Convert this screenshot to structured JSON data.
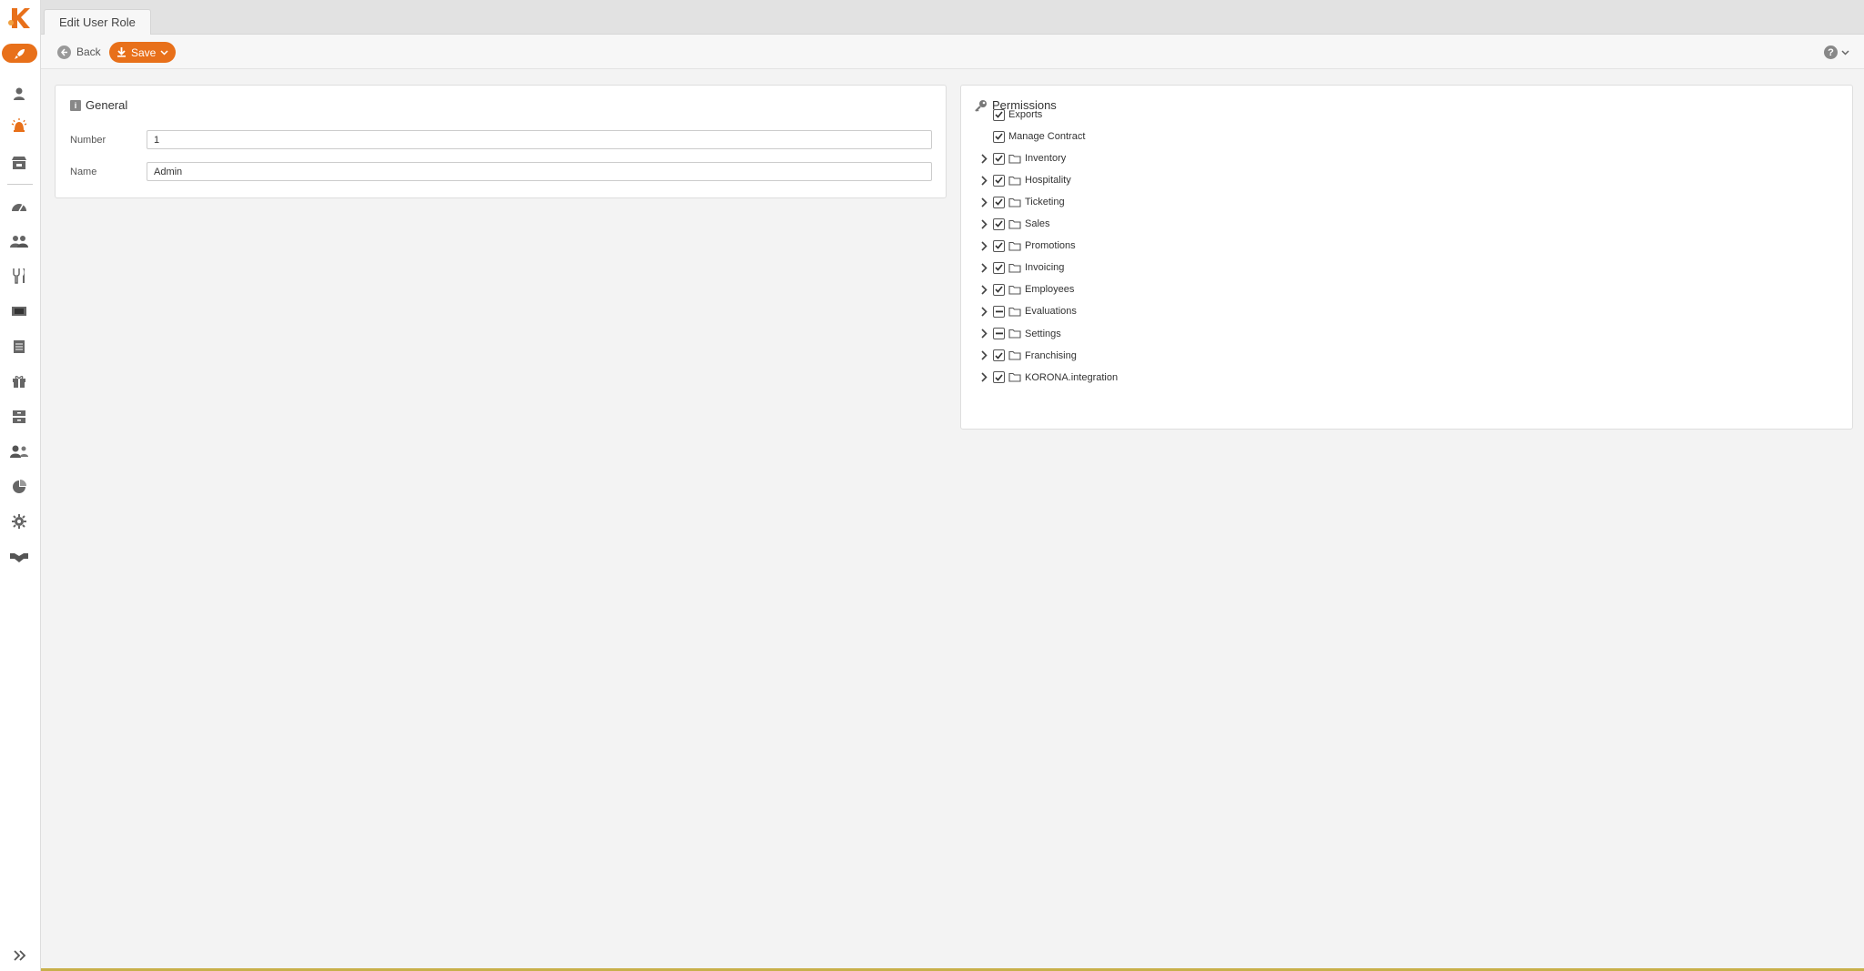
{
  "tab": {
    "title": "Edit User Role"
  },
  "toolbar": {
    "back_label": "Back",
    "save_label": "Save",
    "help_label": "?"
  },
  "general": {
    "title": "General",
    "number_label": "Number",
    "number_value": "1",
    "name_label": "Name",
    "name_value": "Admin"
  },
  "permissions": {
    "title": "Permissions",
    "items": [
      {
        "label": "Exports",
        "state": "checked",
        "expandable": false
      },
      {
        "label": "Manage Contract",
        "state": "checked",
        "expandable": false
      },
      {
        "label": "Inventory",
        "state": "checked",
        "expandable": true
      },
      {
        "label": "Hospitality",
        "state": "checked",
        "expandable": true
      },
      {
        "label": "Ticketing",
        "state": "checked",
        "expandable": true
      },
      {
        "label": "Sales",
        "state": "checked",
        "expandable": true
      },
      {
        "label": "Promotions",
        "state": "checked",
        "expandable": true
      },
      {
        "label": "Invoicing",
        "state": "checked",
        "expandable": true
      },
      {
        "label": "Employees",
        "state": "checked",
        "expandable": true
      },
      {
        "label": "Evaluations",
        "state": "partial",
        "expandable": true
      },
      {
        "label": "Settings",
        "state": "partial",
        "expandable": true
      },
      {
        "label": "Franchising",
        "state": "checked",
        "expandable": true
      },
      {
        "label": "KORONA.integration",
        "state": "checked",
        "expandable": true
      }
    ]
  },
  "sidebar": {
    "icons": [
      "user-icon",
      "bell-icon",
      "store-icon",
      "dashboard-icon",
      "people-icon",
      "restaurant-icon",
      "ticket-icon",
      "list-icon",
      "gift-icon",
      "archive-icon",
      "users-icon",
      "pie-chart-icon",
      "gear-icon",
      "handshake-icon"
    ]
  },
  "colors": {
    "accent": "#e8701a",
    "icon_gray": "#666666"
  }
}
